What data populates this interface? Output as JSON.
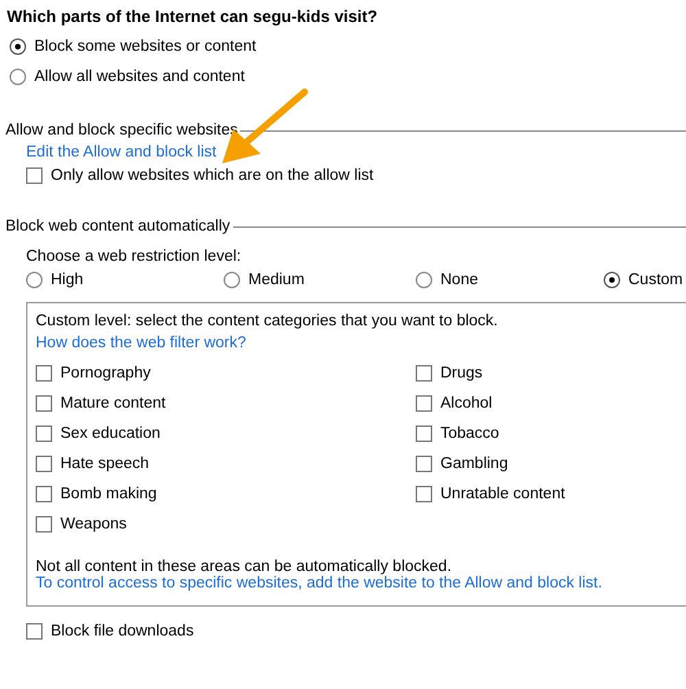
{
  "heading": "Which parts of the Internet can segu-kids visit?",
  "access_options": [
    {
      "label": "Block some websites or content",
      "selected": true
    },
    {
      "label": "Allow all websites and content",
      "selected": false
    }
  ],
  "allow_block_section": {
    "title": "Allow and block specific websites",
    "link": "Edit the Allow and block list",
    "option": {
      "label": "Only allow websites which are on the allow list",
      "checked": false
    }
  },
  "web_content_section": {
    "title": "Block web content automatically",
    "prompt": "Choose a web restriction level:",
    "levels": [
      {
        "label": "High",
        "selected": false
      },
      {
        "label": "Medium",
        "selected": false
      },
      {
        "label": "None",
        "selected": false
      },
      {
        "label": "Custom",
        "selected": true
      }
    ],
    "custom_panel": {
      "intro": "Custom level:  select the content categories that you want to block.",
      "help_link": "How does the web filter work?",
      "categories_left": [
        {
          "label": "Pornography",
          "checked": false
        },
        {
          "label": "Mature content",
          "checked": false
        },
        {
          "label": "Sex education",
          "checked": false
        },
        {
          "label": "Hate speech",
          "checked": false
        },
        {
          "label": "Bomb making",
          "checked": false
        },
        {
          "label": "Weapons",
          "checked": false
        }
      ],
      "categories_right": [
        {
          "label": "Drugs",
          "checked": false
        },
        {
          "label": "Alcohol",
          "checked": false
        },
        {
          "label": "Tobacco",
          "checked": false
        },
        {
          "label": "Gambling",
          "checked": false
        },
        {
          "label": "Unratable content",
          "checked": false
        }
      ],
      "note": "Not all content in these areas can be automatically blocked.",
      "note_link": "To control access to specific websites, add the website to the Allow and block list."
    }
  },
  "block_downloads": {
    "label": "Block file downloads",
    "checked": false
  }
}
